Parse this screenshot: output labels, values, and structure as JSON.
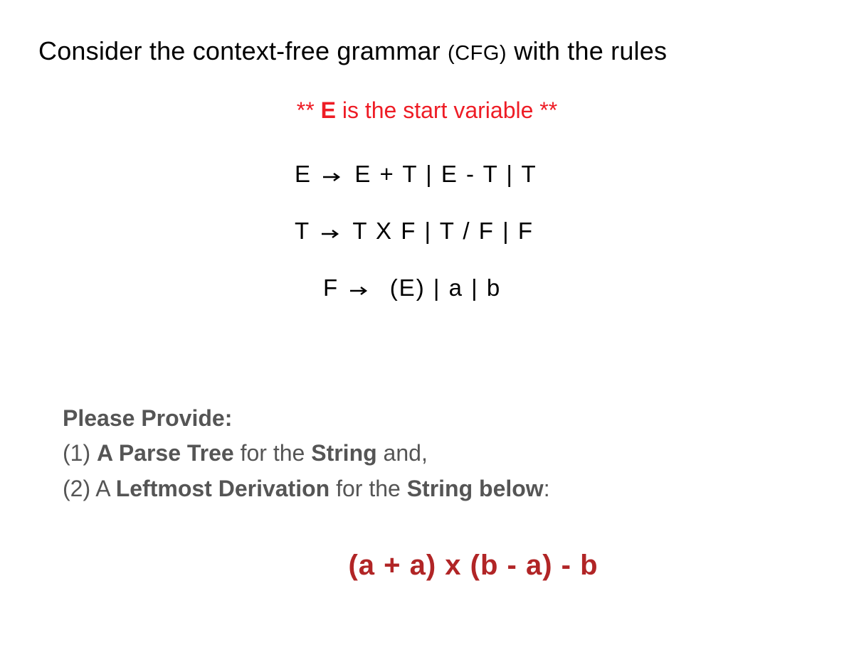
{
  "headline": {
    "pre": "Consider the context-free grammar ",
    "abbr": "(CFG)",
    "post": " with the rules"
  },
  "start_note": {
    "prefix": "** ",
    "symbol": "E",
    "rest": " is the start variable **"
  },
  "grammar": {
    "rule1": {
      "lhs": "E",
      "rhs": "E + T | E - T | T"
    },
    "rule2": {
      "lhs": "T",
      "rhs": "T X F | T / F | F"
    },
    "rule3": {
      "lhs": "F",
      "rhs": "(E) | a | b"
    }
  },
  "tasks": {
    "lead": "Please Provide:",
    "item1": {
      "num": "(1)  ",
      "b1": "A Parse Tree",
      "mid": " for the ",
      "b2": "String",
      "tail": " and,"
    },
    "item2": {
      "num": "(2)   A ",
      "b1": "Leftmost Derivation",
      "mid": " for the ",
      "b2": "String below",
      "tail": ":"
    }
  },
  "target_string": "(a + a) x (b - a) - b"
}
